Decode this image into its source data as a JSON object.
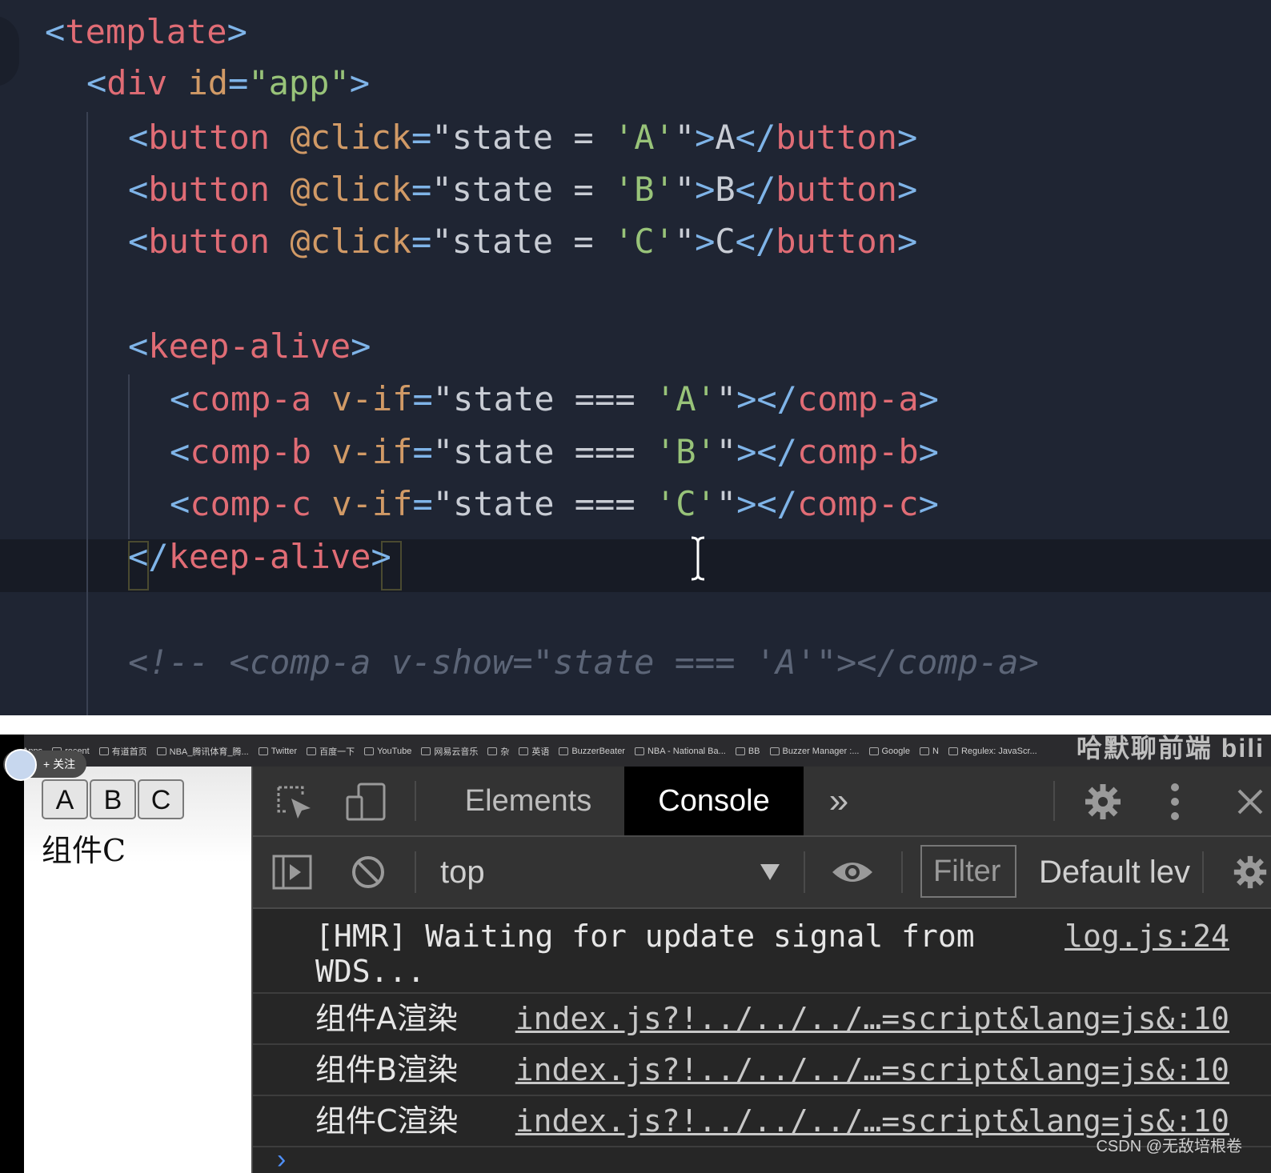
{
  "editor": {
    "lines": [
      {
        "parts": [
          [
            "t-br",
            "<"
          ],
          [
            "t-tag",
            "template"
          ],
          [
            "t-br",
            ">"
          ]
        ]
      },
      {
        "parts": [
          [
            "t-br",
            "<"
          ],
          [
            "t-tag",
            "div "
          ],
          [
            "t-attr",
            "id"
          ],
          [
            "t-eq",
            "="
          ],
          [
            "t-str",
            "\"app\""
          ],
          [
            "t-br",
            ">"
          ]
        ]
      },
      {
        "parts": [
          [
            "t-br",
            "<"
          ],
          [
            "t-tag",
            "button "
          ],
          [
            "t-attr",
            "@click"
          ],
          [
            "t-eq",
            "="
          ],
          [
            "t-plain",
            "\"state = "
          ],
          [
            "t-str",
            "'A'"
          ],
          [
            "t-plain",
            "\""
          ],
          [
            "t-br",
            ">"
          ],
          [
            "t-plain",
            "A"
          ],
          [
            "t-br",
            "</"
          ],
          [
            "t-tag",
            "button"
          ],
          [
            "t-br",
            ">"
          ]
        ]
      },
      {
        "parts": [
          [
            "t-br",
            "<"
          ],
          [
            "t-tag",
            "button "
          ],
          [
            "t-attr",
            "@click"
          ],
          [
            "t-eq",
            "="
          ],
          [
            "t-plain",
            "\"state = "
          ],
          [
            "t-str",
            "'B'"
          ],
          [
            "t-plain",
            "\""
          ],
          [
            "t-br",
            ">"
          ],
          [
            "t-plain",
            "B"
          ],
          [
            "t-br",
            "</"
          ],
          [
            "t-tag",
            "button"
          ],
          [
            "t-br",
            ">"
          ]
        ]
      },
      {
        "parts": [
          [
            "t-br",
            "<"
          ],
          [
            "t-tag",
            "button "
          ],
          [
            "t-attr",
            "@click"
          ],
          [
            "t-eq",
            "="
          ],
          [
            "t-plain",
            "\"state = "
          ],
          [
            "t-str",
            "'C'"
          ],
          [
            "t-plain",
            "\""
          ],
          [
            "t-br",
            ">"
          ],
          [
            "t-plain",
            "C"
          ],
          [
            "t-br",
            "</"
          ],
          [
            "t-tag",
            "button"
          ],
          [
            "t-br",
            ">"
          ]
        ]
      },
      {
        "parts": []
      },
      {
        "parts": [
          [
            "t-br",
            "<"
          ],
          [
            "t-tag",
            "keep-alive"
          ],
          [
            "t-br",
            ">"
          ]
        ]
      },
      {
        "parts": [
          [
            "t-br",
            "<"
          ],
          [
            "t-tag",
            "comp-a "
          ],
          [
            "t-attr",
            "v-if"
          ],
          [
            "t-eq",
            "="
          ],
          [
            "t-plain",
            "\"state === "
          ],
          [
            "t-str",
            "'A'"
          ],
          [
            "t-plain",
            "\""
          ],
          [
            "t-br",
            "></"
          ],
          [
            "t-tag",
            "comp-a"
          ],
          [
            "t-br",
            ">"
          ]
        ]
      },
      {
        "parts": [
          [
            "t-br",
            "<"
          ],
          [
            "t-tag",
            "comp-b "
          ],
          [
            "t-attr",
            "v-if"
          ],
          [
            "t-eq",
            "="
          ],
          [
            "t-plain",
            "\"state === "
          ],
          [
            "t-str",
            "'B'"
          ],
          [
            "t-plain",
            "\""
          ],
          [
            "t-br",
            "></"
          ],
          [
            "t-tag",
            "comp-b"
          ],
          [
            "t-br",
            ">"
          ]
        ]
      },
      {
        "parts": [
          [
            "t-br",
            "<"
          ],
          [
            "t-tag",
            "comp-c "
          ],
          [
            "t-attr",
            "v-if"
          ],
          [
            "t-eq",
            "="
          ],
          [
            "t-plain",
            "\"state === "
          ],
          [
            "t-str",
            "'C'"
          ],
          [
            "t-plain",
            "\""
          ],
          [
            "t-br",
            "></"
          ],
          [
            "t-tag",
            "comp-c"
          ],
          [
            "t-br",
            ">"
          ]
        ]
      },
      {
        "parts": [
          [
            "t-br",
            "</"
          ],
          [
            "t-tag",
            "keep-alive"
          ],
          [
            "t-br",
            ">"
          ]
        ]
      },
      {
        "parts": []
      },
      {
        "parts": [
          [
            "t-com",
            "<!-- <comp-a v-show=\"state === 'A'\"></comp-a>"
          ]
        ]
      }
    ]
  },
  "bookmarks": [
    {
      "label": "Apps"
    },
    {
      "label": "recent"
    },
    {
      "label": "有道首页"
    },
    {
      "label": "NBA_腾讯体育_腾..."
    },
    {
      "label": "Twitter"
    },
    {
      "label": "百度一下"
    },
    {
      "label": "YouTube"
    },
    {
      "label": "网易云音乐"
    },
    {
      "label": "杂"
    },
    {
      "label": "英语"
    },
    {
      "label": "BuzzerBeater"
    },
    {
      "label": "NBA - National Ba..."
    },
    {
      "label": "BB"
    },
    {
      "label": "Buzzer Manager :..."
    },
    {
      "label": "Google"
    },
    {
      "label": "N"
    },
    {
      "label": "Regulex: JavaScr..."
    }
  ],
  "brand": "哈默聊前端  bili",
  "follow_label": "+ 关注",
  "app": {
    "buttons": [
      "A",
      "B",
      "C"
    ],
    "component_text": "组件C"
  },
  "devtools": {
    "tabs": {
      "elements": "Elements",
      "console": "Console",
      "more": "»"
    },
    "context": "top",
    "filter_placeholder": "Filter",
    "levels": "Default lev",
    "messages": [
      {
        "text": "[HMR] Waiting for update signal from\nWDS...",
        "source": "log.js:24"
      },
      {
        "text": "组件A渲染",
        "source": "index.js?!../../../…=script&lang=js&:10"
      },
      {
        "text": "组件B渲染",
        "source": "index.js?!../../../…=script&lang=js&:10"
      },
      {
        "text": "组件C渲染",
        "source": "index.js?!../../../…=script&lang=js&:10"
      }
    ],
    "prompt": "›"
  },
  "watermark": "CSDN @无敌培根卷"
}
